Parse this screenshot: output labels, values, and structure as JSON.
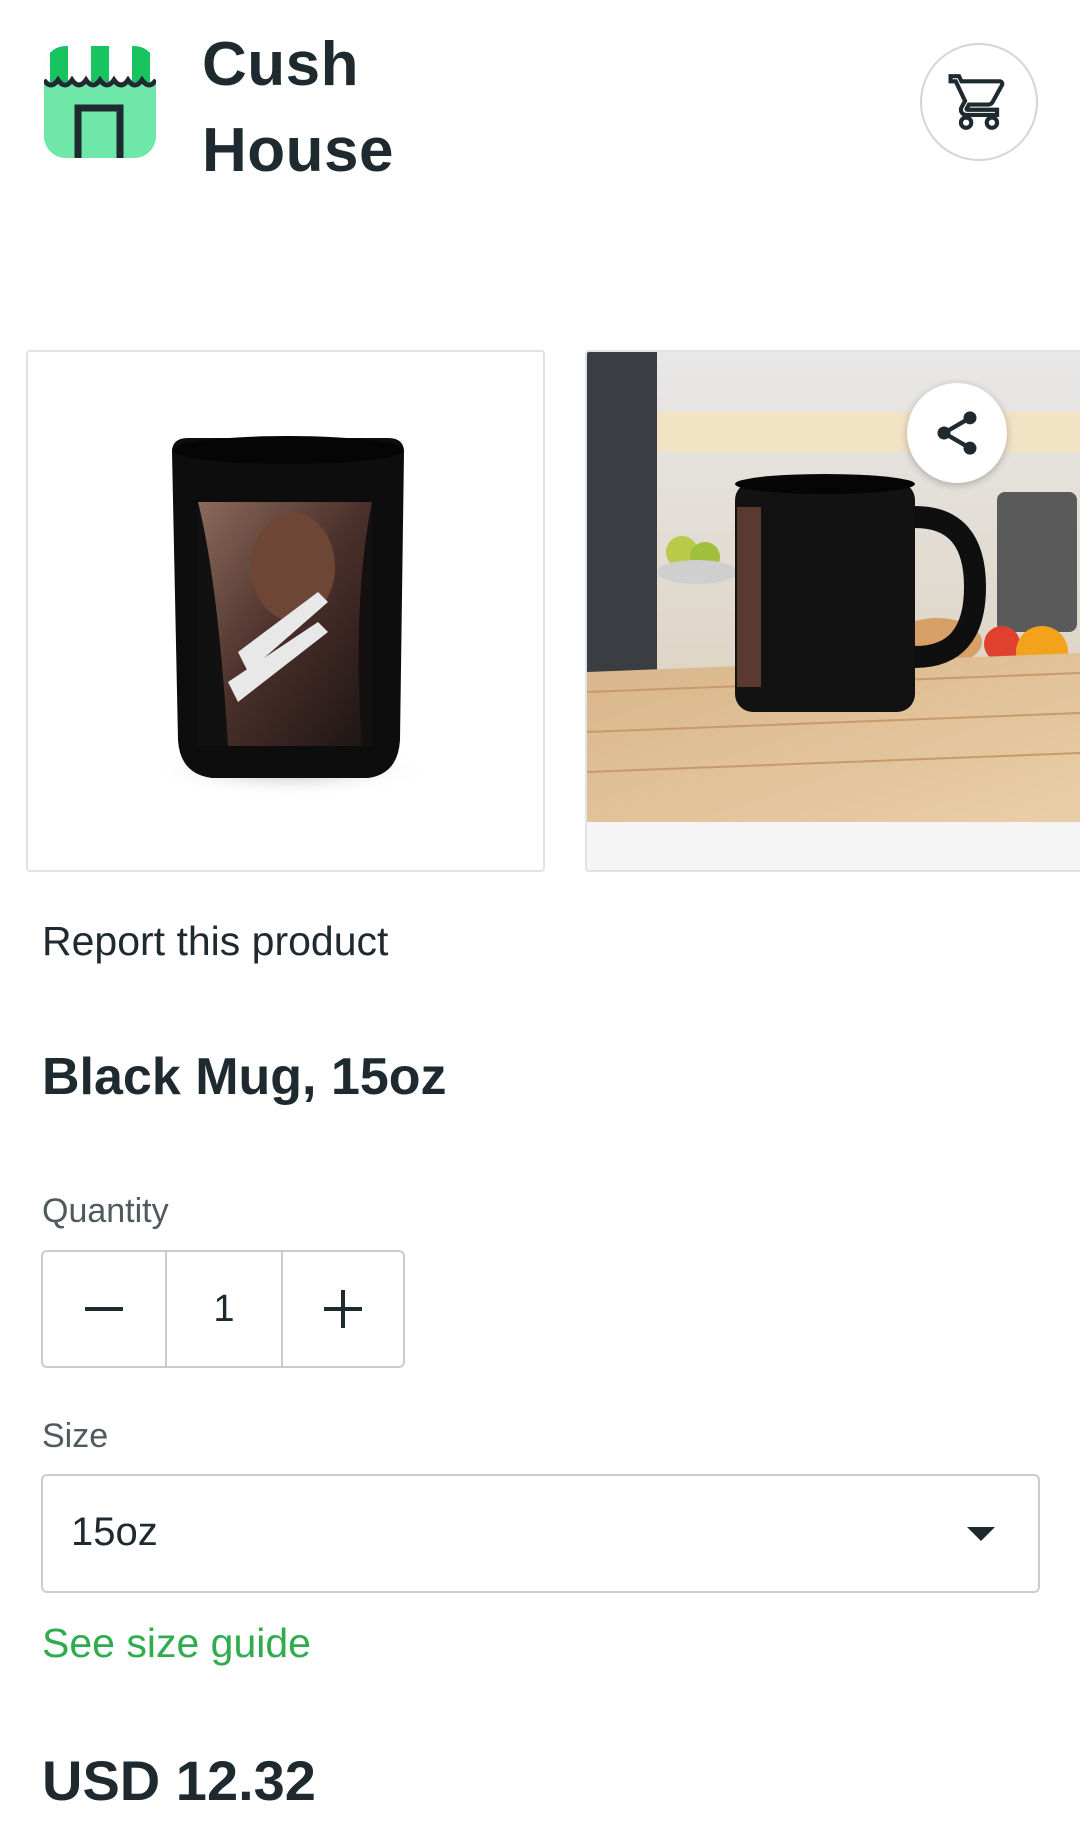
{
  "header": {
    "store_name_line1": "Cush",
    "store_name_line2": "House",
    "logo_icon": "storefront-icon",
    "cart_icon": "shopping-cart-icon",
    "brand_color": "#6ee7a8"
  },
  "gallery": {
    "images": [
      {
        "description_icon": "black-mug-front-photo"
      },
      {
        "description_icon": "black-mug-kitchen-photo"
      }
    ],
    "share_icon": "share-icon"
  },
  "product": {
    "report_link": "Report this product",
    "title": "Black Mug, 15oz",
    "quantity_label": "Quantity",
    "quantity_value": "1",
    "size_label": "Size",
    "size_value": "15oz",
    "size_guide_link": "See size guide",
    "price": "USD 12.32",
    "link_color": "#2fac4e"
  }
}
